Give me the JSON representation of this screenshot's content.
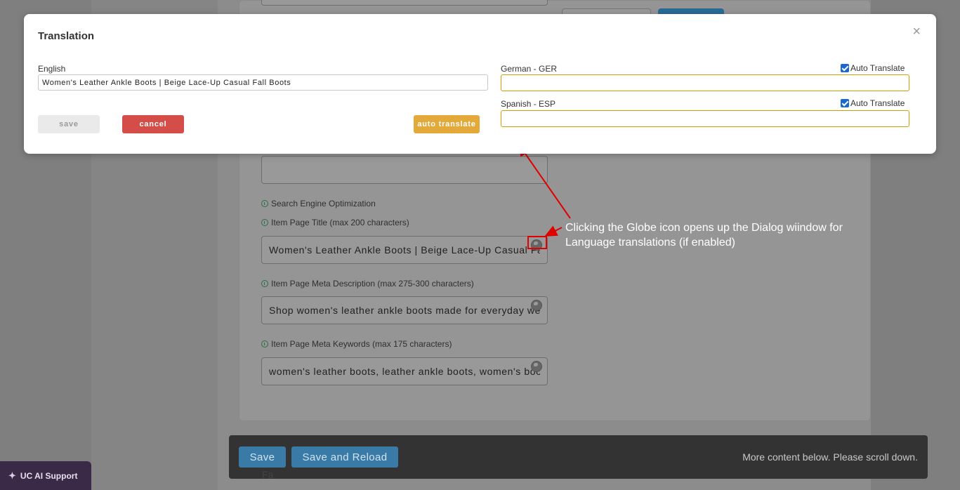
{
  "background": {
    "labels": {
      "seo": "Search Engine Optimization",
      "title": "Item Page Title (max 200 characters)",
      "meta_desc": "Item Page Meta Description (max 275-300 characters)",
      "meta_keywords": "Item Page Meta Keywords (max 175 characters)"
    },
    "fields": {
      "title": "Women's Leather Ankle Boots | Beige Lace-Up Casual Fall Boots",
      "meta_desc": "Shop women's leather ankle boots made for everyday wear",
      "meta_keywords": "women's leather boots, leather ankle boots, women's boots"
    },
    "below_text": "Fa",
    "annotation": "Clicking the Globe icon opens up the Dialog wiindow for Language translations (if enabled)"
  },
  "dialog": {
    "title": "Translation",
    "close_glyph": "×",
    "english_label": "English",
    "english_value": "Women's Leather Ankle Boots | Beige Lace-Up Casual Fall Boots",
    "languages": [
      {
        "label": "German - GER",
        "auto_label": "Auto Translate",
        "auto_checked": true,
        "value": ""
      },
      {
        "label": "Spanish - ESP",
        "auto_label": "Auto Translate",
        "auto_checked": true,
        "value": ""
      }
    ],
    "buttons": {
      "save": "save",
      "cancel": "cancel",
      "auto_translate": "auto translate"
    }
  },
  "footer": {
    "save": "Save",
    "save_reload": "Save and Reload",
    "note": "More content below. Please scroll down."
  },
  "ai_support": {
    "label": "UC AI Support"
  },
  "colors": {
    "cancel": "#d44d49",
    "auto_translate": "#e3a93a",
    "input_border": "#d39e00",
    "annotation": "#e00000",
    "footer_button": "#3a7aa6"
  }
}
